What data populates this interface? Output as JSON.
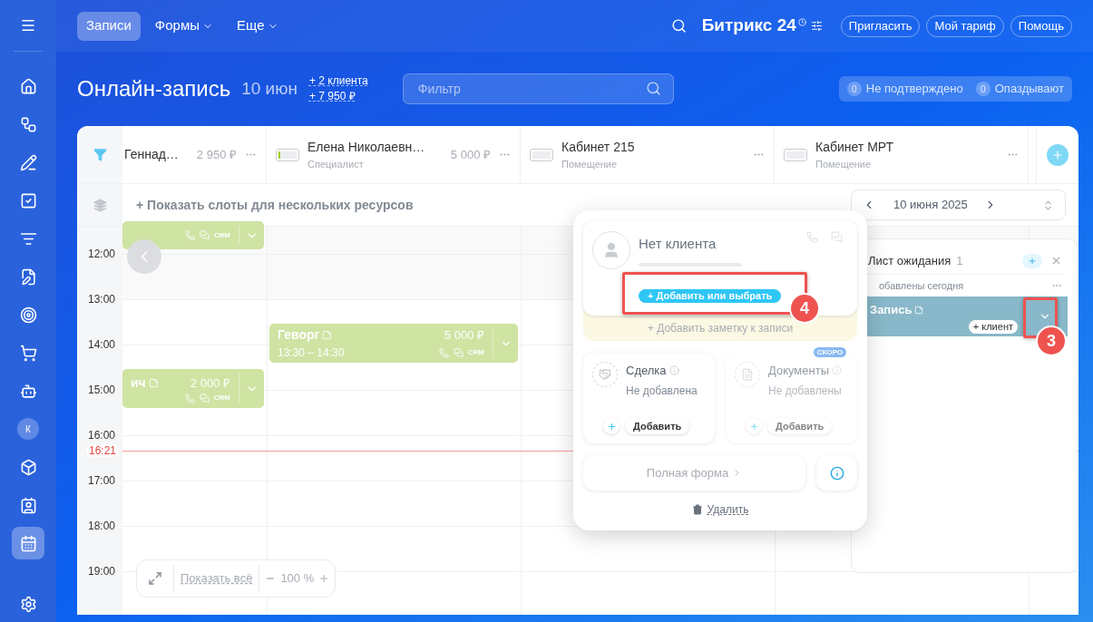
{
  "sidebar": {
    "items": [
      {
        "kind": "icon",
        "selected": false
      },
      {
        "kind": "icon",
        "selected": false
      },
      {
        "kind": "icon",
        "selected": false
      },
      {
        "kind": "icon",
        "selected": false
      },
      {
        "kind": "icon",
        "selected": false
      },
      {
        "kind": "icon",
        "selected": false
      },
      {
        "kind": "icon",
        "selected": false
      },
      {
        "kind": "icon",
        "selected": false
      },
      {
        "kind": "icon",
        "selected": false
      },
      {
        "kind": "avatar",
        "initial": "К",
        "selected": false
      },
      {
        "kind": "icon",
        "selected": false
      },
      {
        "kind": "icon",
        "selected": false
      },
      {
        "kind": "icon",
        "selected": true
      }
    ]
  },
  "top_nav": {
    "tabs": [
      {
        "label": "Записи",
        "selected": true,
        "has_menu": false
      },
      {
        "label": "Формы",
        "selected": false,
        "has_menu": true
      },
      {
        "label": "Еще",
        "selected": false,
        "has_menu": true
      }
    ],
    "brand": "Битрикс 24",
    "buttons": [
      "Пригласить",
      "Мой тариф",
      "Помощь"
    ]
  },
  "page_header": {
    "title": "Онлайн-запись",
    "date": "10 июн",
    "stats": [
      "+ 2 клиента",
      "+ 7 950 ₽"
    ],
    "filter": {
      "placeholder": "Фильтр"
    },
    "counters": [
      {
        "count": "0",
        "label": "Не подтверждено"
      },
      {
        "count": "0",
        "label": "Опаздывают"
      }
    ]
  },
  "resources": [
    {
      "name": "Геннад…",
      "price": "2 950 ₽"
    },
    {
      "name": "Елена Николаевн…",
      "type": "Специалист",
      "price": "5 000 ₽",
      "level": 0.12
    },
    {
      "name": "Кабинет 215",
      "type": "Помещение",
      "level": 0
    },
    {
      "name": "Кабинет МРТ",
      "type": "Помещение",
      "level": 0
    }
  ],
  "show_slots": "+ Показать слоты для нескольких ресурсов",
  "date_picker": "10 июня 2025",
  "timeline": {
    "hours": [
      "12:00",
      "13:00",
      "14:00",
      "15:00",
      "16:00",
      "17:00",
      "18:00",
      "19:00"
    ],
    "current_time": "16:21"
  },
  "bookings": [
    {
      "crm": "CRM"
    },
    {
      "name": "ич",
      "has_note": true,
      "price": "2 000 ₽",
      "crm": "CRM"
    },
    {
      "name": "Геворг",
      "has_note": true,
      "time": "13:30 – 14:30",
      "price": "5 000 ₽",
      "crm": "CRM"
    }
  ],
  "popup": {
    "client": "Нет клиента",
    "add_client": "+ Добавить или выбрать",
    "note": "+ Добавить заметку к записи",
    "cards": [
      {
        "title": "Сделка",
        "status": "Не добавлена",
        "action": "Добавить",
        "disabled": false
      },
      {
        "title": "Документы",
        "status": "Не добавлены",
        "action": "Добавить",
        "disabled": true,
        "badge": "СКОРО"
      }
    ],
    "full_form": "Полная форма",
    "delete": "Удалить"
  },
  "waiting_list": {
    "title": "Лист ожидания",
    "count": "1",
    "section": "обавлены сегодня",
    "entry": {
      "title": "Запись",
      "client_button": "+ клиент"
    }
  },
  "zoom_control": {
    "show_all": "Показать всё",
    "zoom": "100 %"
  },
  "annotations": [
    {
      "number": "3"
    },
    {
      "number": "4"
    }
  ]
}
